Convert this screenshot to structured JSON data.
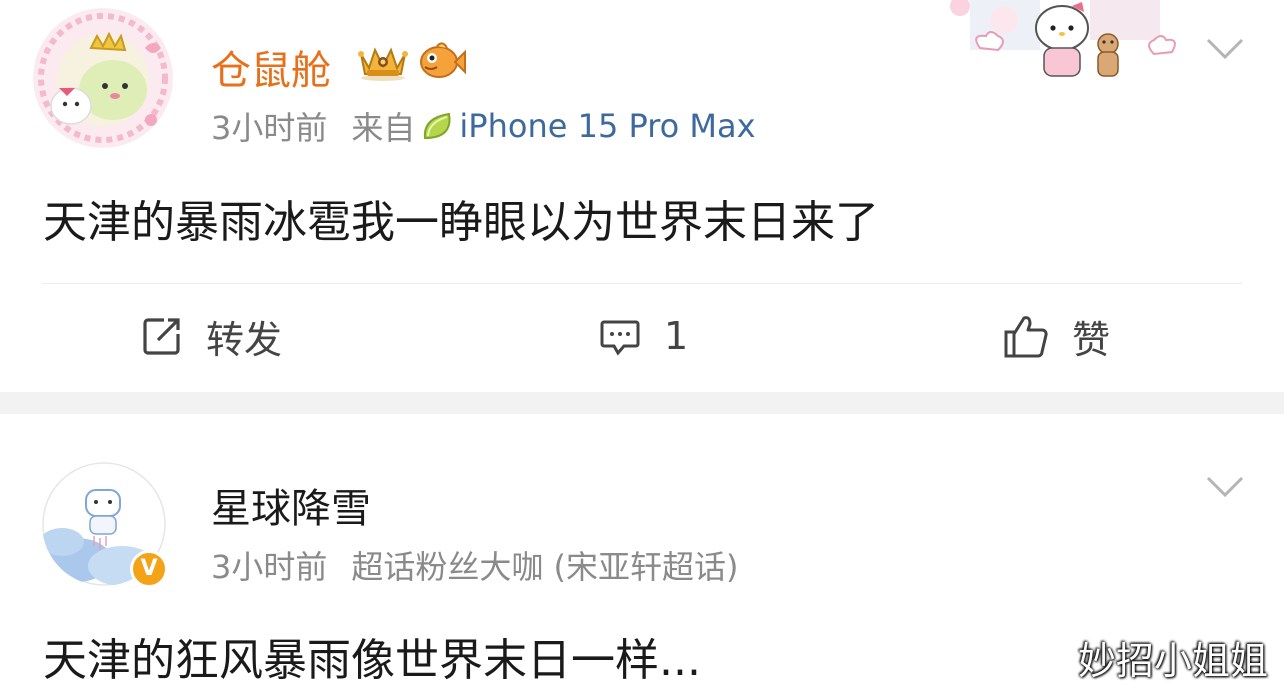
{
  "posts": [
    {
      "username": "仓鼠舱",
      "time": "3小时前",
      "source_prefix": "来自",
      "device": "iPhone 15 Pro Max",
      "content": "天津的暴雨冰雹我一睁眼以为世界末日来了",
      "badges": [
        "crown-badge",
        "fish-badge"
      ],
      "actions": {
        "repost_label": "转发",
        "comment_count": "1",
        "like_label": "赞"
      }
    },
    {
      "username": "星球降雪",
      "time": "3小时前",
      "tag": "超话粉丝大咖 (宋亚轩超话)",
      "content": "天津的狂风暴雨像世界末日一样...",
      "verified_mark": "V"
    }
  ],
  "watermark": "妙招小姐姐",
  "colors": {
    "username_orange": "#e8701a",
    "device_blue": "#3d6a9c",
    "meta_gray": "#8a8a8a",
    "separator": "#f2f2f2"
  },
  "icons": [
    "chevron-down-icon",
    "repost-icon",
    "comment-icon",
    "like-icon",
    "lime-icon"
  ]
}
